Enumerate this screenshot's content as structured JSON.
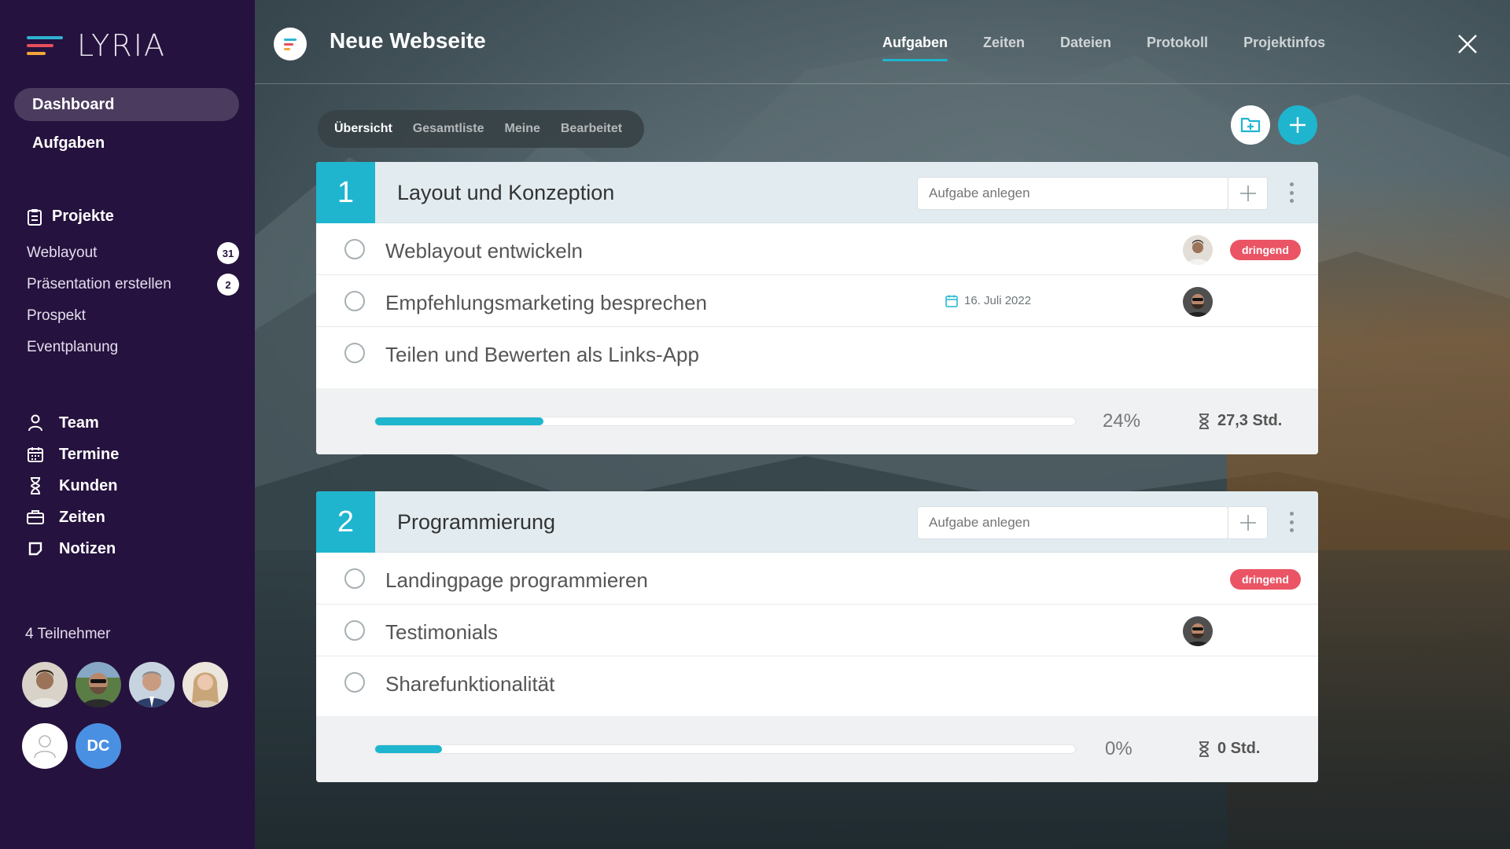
{
  "brand": {
    "name": "LYRIA"
  },
  "sidebar": {
    "main_items": [
      {
        "label": "Dashboard",
        "active": true
      },
      {
        "label": "Aufgaben",
        "active": false
      }
    ],
    "projects_heading": "Projekte",
    "projects": [
      {
        "label": "Weblayout",
        "count": "31"
      },
      {
        "label": "Präsentation erstellen",
        "count": "2"
      },
      {
        "label": "Prospekt",
        "count": null
      },
      {
        "label": "Eventplanung",
        "count": null
      }
    ],
    "secondary_items": [
      {
        "label": "Team",
        "icon": "user-icon"
      },
      {
        "label": "Termine",
        "icon": "calendar-icon"
      },
      {
        "label": "Kunden",
        "icon": "hourglass-icon"
      },
      {
        "label": "Zeiten",
        "icon": "briefcase-icon"
      },
      {
        "label": "Notizen",
        "icon": "note-icon"
      }
    ],
    "participants_label": "4 Teilnehmer",
    "participant_initials": "DC"
  },
  "header": {
    "title": "Neue Webseite",
    "tabs": [
      {
        "label": "Aufgaben",
        "active": true
      },
      {
        "label": "Zeiten",
        "active": false
      },
      {
        "label": "Dateien",
        "active": false
      },
      {
        "label": "Protokoll",
        "active": false
      },
      {
        "label": "Projektinfos",
        "active": false
      }
    ]
  },
  "subnav": [
    "Übersicht",
    "Gesamtliste",
    "Meine",
    "Bearbeitet"
  ],
  "lists": [
    {
      "number": "1",
      "title": "Layout und Konzeption",
      "input_placeholder": "Aufgabe anlegen",
      "tasks": [
        {
          "name": "Weblayout entwickeln",
          "badge": "dringend"
        },
        {
          "name": "Empfehlungsmarketing besprechen",
          "date": "16. Juli 2022"
        },
        {
          "name": "Teilen und Bewerten als Links-App"
        }
      ],
      "progress": 0.24,
      "progress_label": "24%",
      "hours": "27,3 Std."
    },
    {
      "number": "2",
      "title": "Programmierung",
      "input_placeholder": "Aufgabe anlegen",
      "tasks": [
        {
          "name": "Landingpage programmieren",
          "badge": "dringend"
        },
        {
          "name": "Testimonials"
        },
        {
          "name": "Sharefunktionalität"
        }
      ],
      "progress": 0.0,
      "progress_label": "0%",
      "hours": "0 Std."
    }
  ],
  "colors": {
    "sidebar_bg": "#25123e",
    "accent": "#1fb5cf",
    "urgent": "#ea5464"
  }
}
